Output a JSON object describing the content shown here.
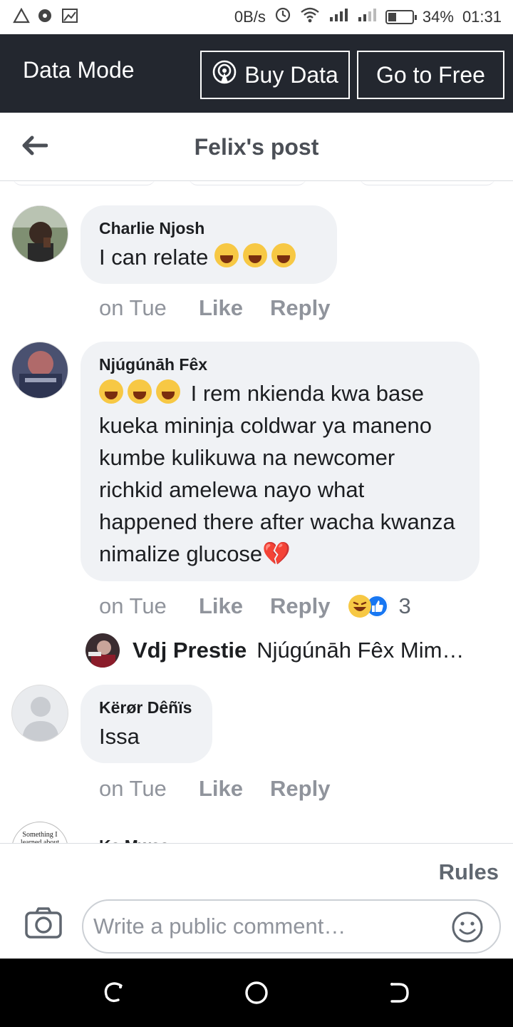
{
  "status_bar": {
    "speed": "0B/s",
    "battery_percent": "34%",
    "battery_level": 0.34,
    "time": "01:31"
  },
  "data_mode": {
    "title": "Data Mode",
    "buy_label": "Buy Data",
    "free_label": "Go to Free"
  },
  "header": {
    "title": "Felix's post"
  },
  "comments": [
    {
      "name": "Charlie Njosh",
      "text": "I can relate",
      "time": "on Tue",
      "like": "Like",
      "reply": "Reply"
    },
    {
      "name": "Njúgúnāh Fêx",
      "text": "I rem nkienda kwa base kueka mininja coldwar ya maneno kumbe kulikuwa na newcomer richkid amelewa nayo what happened there after wacha kwanza nimalize glucose",
      "time": "on Tue",
      "like": "Like",
      "reply": "Reply",
      "reaction_count": "3",
      "reply_preview": {
        "name": "Vdj Prestie",
        "text": "Njúgúnāh Fêx Mim…"
      }
    },
    {
      "name": "Kërør Dêñïs",
      "text": "Issa",
      "time": "on Tue",
      "like": "Like",
      "reply": "Reply"
    },
    {
      "name": "Ka Mwas",
      "avatar_text": "Something I learned about"
    }
  ],
  "composer": {
    "rules": "Rules",
    "placeholder": "Write a public comment…"
  },
  "colors": {
    "data_bar": "#23272f",
    "bubble": "#f0f2f5",
    "meta_text": "#90949c",
    "like_blue": "#1877f2",
    "haha_yellow": "#f7c844"
  }
}
